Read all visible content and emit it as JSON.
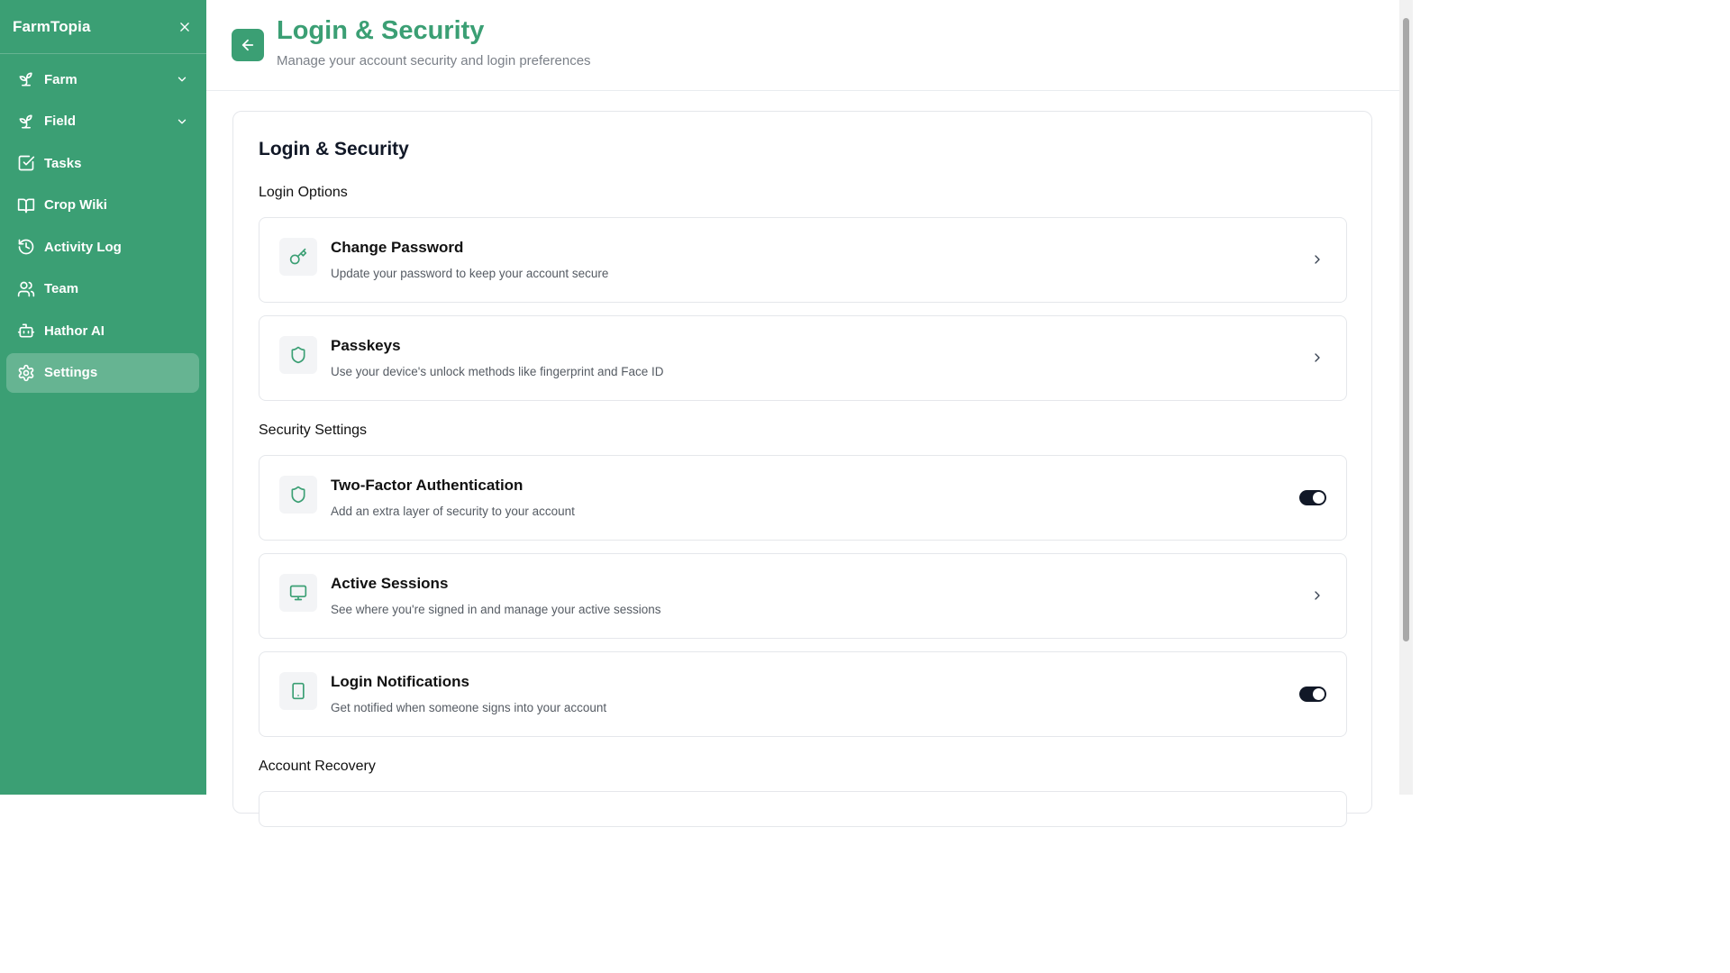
{
  "brand": {
    "name": "FarmTopia"
  },
  "sidebar": {
    "items": [
      {
        "label": "Farm",
        "icon": "sprout-icon",
        "has_dropdown": true
      },
      {
        "label": "Field",
        "icon": "sprout-icon",
        "has_dropdown": true
      },
      {
        "label": "Tasks",
        "icon": "checkbox-icon"
      },
      {
        "label": "Crop Wiki",
        "icon": "book-icon"
      },
      {
        "label": "Activity Log",
        "icon": "history-icon"
      },
      {
        "label": "Team",
        "icon": "users-icon"
      },
      {
        "label": "Hathor AI",
        "icon": "bot-icon"
      },
      {
        "label": "Settings",
        "icon": "gear-icon",
        "active": true
      }
    ]
  },
  "header": {
    "title": "Login & Security",
    "subtitle": "Manage your account security and login preferences"
  },
  "card": {
    "title": "Login & Security",
    "sections": {
      "login_options": "Login Options",
      "security_settings": "Security Settings",
      "account_recovery": "Account Recovery"
    },
    "rows": [
      {
        "title": "Change Password",
        "description": "Update your password to keep your account secure",
        "icon": "key-icon",
        "control": "chevron"
      },
      {
        "title": "Passkeys",
        "description": "Use your device's unlock methods like fingerprint and Face ID",
        "icon": "shield-icon",
        "control": "chevron"
      },
      {
        "title": "Two-Factor Authentication",
        "description": "Add an extra layer of security to your account",
        "icon": "shield-icon",
        "control": "toggle",
        "enabled": true
      },
      {
        "title": "Active Sessions",
        "description": "See where you're signed in and manage your active sessions",
        "icon": "monitor-icon",
        "control": "chevron"
      },
      {
        "title": "Login Notifications",
        "description": "Get notified when someone signs into your account",
        "icon": "smartphone-icon",
        "control": "toggle",
        "enabled": true
      }
    ]
  },
  "colors": {
    "brand_green": "#3b9f74",
    "toggle_on": "#111827"
  }
}
